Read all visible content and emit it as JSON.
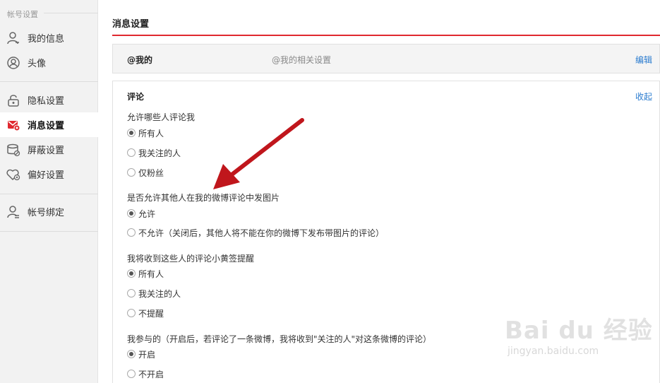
{
  "sidebar": {
    "section_title": "帐号设置",
    "items": [
      {
        "label": "我的信息",
        "icon": "user-icon"
      },
      {
        "label": "头像",
        "icon": "avatar-icon"
      },
      {
        "label": "隐私设置",
        "icon": "lock-icon"
      },
      {
        "label": "消息设置",
        "icon": "message-settings-icon",
        "active": true
      },
      {
        "label": "屏蔽设置",
        "icon": "block-icon"
      },
      {
        "label": "偏好设置",
        "icon": "heart-settings-icon"
      },
      {
        "label": "帐号绑定",
        "icon": "account-bind-icon"
      }
    ]
  },
  "main": {
    "title": "消息设置",
    "at_panel": {
      "title": "@我的",
      "desc": "@我的相关设置",
      "edit": "编辑"
    },
    "comment_panel": {
      "title": "评论",
      "collapse": "收起",
      "questions": [
        {
          "label": "允许哪些人评论我",
          "options": [
            "所有人",
            "我关注的人",
            "仅粉丝"
          ],
          "selected": 0
        },
        {
          "label": "是否允许其他人在我的微博评论中发图片",
          "options": [
            "允许",
            "不允许（关闭后，其他人将不能在你的微博下发布带图片的评论）"
          ],
          "selected": 0
        },
        {
          "label": "我将收到这些人的评论小黄签提醒",
          "options": [
            "所有人",
            "我关注的人",
            "不提醒"
          ],
          "selected": 0
        },
        {
          "label": "我参与的（开启后，若评论了一条微博，我将收到\"关注的人\"对这条微博的评论）",
          "options": [
            "开启",
            "不开启"
          ],
          "selected": 0
        }
      ]
    }
  },
  "colors": {
    "accent_red": "#e0282f",
    "link_blue": "#2b7ccf",
    "annotation_arrow": "#c0161c"
  },
  "watermark": {
    "brand": "Bai du 经验",
    "url": "jingyan.baidu.com"
  }
}
